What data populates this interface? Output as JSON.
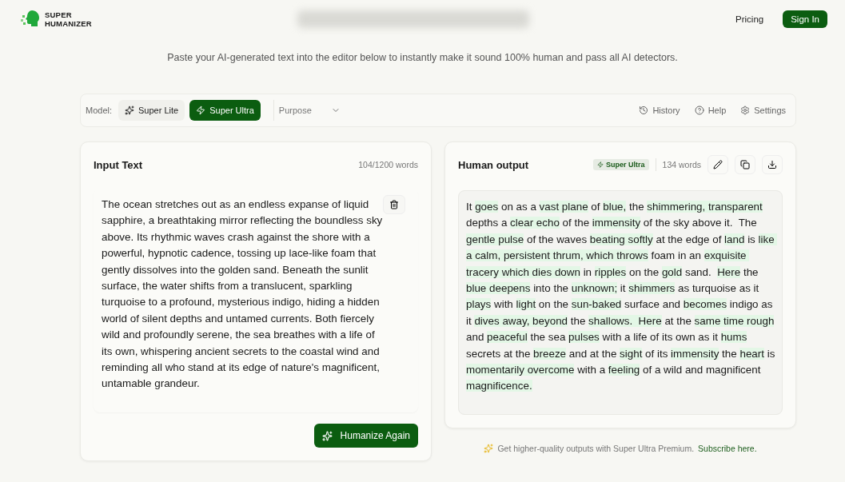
{
  "header": {
    "logo": [
      "SUPER",
      "HUMANIZER"
    ],
    "nav": [
      {
        "label": "Pricing",
        "kind": "link"
      },
      {
        "label": "Sign In",
        "kind": "button"
      }
    ]
  },
  "subtitle": "Paste your AI-generated text into the editor below to instantly make it sound 100% human and pass all AI detectors.",
  "toolbar": {
    "model_label": "Model:",
    "models": [
      {
        "label": "Super Lite",
        "selected": false
      },
      {
        "label": "Super Ultra",
        "selected": true
      }
    ],
    "purpose": {
      "placeholder": "Purpose"
    },
    "actions": [
      {
        "label": "History",
        "kind": "history"
      },
      {
        "label": "Help",
        "kind": "help"
      },
      {
        "label": "Settings",
        "kind": "settings"
      }
    ]
  },
  "input": {
    "title": "Input Text",
    "count": "104/1200 words",
    "text": "The ocean stretches out as an endless expanse of liquid sapphire, a breathtaking mirror reflecting the boundless sky above. Its rhythmic waves crash against the shore with a powerful, hypnotic cadence, tossing up lace-like foam that gently dissolves into the golden sand. Beneath the sunlit surface, the water shifts from a translucent, sparkling turquoise to a profound, mysterious indigo, hiding a hidden world of silent depths and untamed currents. Both fiercely wild and profoundly serene, the sea breathes with a life of its own, whispering ancient secrets to the coastal wind and reminding all who stand at its edge of nature's magnificent, untamable grandeur.",
    "button": "Humanize Again"
  },
  "output": {
    "title": "Human output",
    "badge": "Super Ultra",
    "count": "134 words",
    "segments": [
      {
        "text": "It ",
        "highlighted": false
      },
      {
        "text": "goes",
        "highlighted": true
      },
      {
        "text": " on as a ",
        "highlighted": false
      },
      {
        "text": "vast plane",
        "highlighted": true
      },
      {
        "text": " of ",
        "highlighted": false
      },
      {
        "text": "blue,",
        "highlighted": true
      },
      {
        "text": " the ",
        "highlighted": false
      },
      {
        "text": "shimmering, transparent",
        "highlighted": true
      },
      {
        "text": " depths a ",
        "highlighted": false
      },
      {
        "text": "clear echo",
        "highlighted": true
      },
      {
        "text": " of the ",
        "highlighted": false
      },
      {
        "text": "immensity",
        "highlighted": true
      },
      {
        "text": " of the sky above it.  The ",
        "highlighted": false
      },
      {
        "text": "gentle pulse",
        "highlighted": true
      },
      {
        "text": " of the waves ",
        "highlighted": false
      },
      {
        "text": "beating softly",
        "highlighted": true
      },
      {
        "text": " at the edge of ",
        "highlighted": false
      },
      {
        "text": "land",
        "highlighted": true
      },
      {
        "text": " is ",
        "highlighted": false
      },
      {
        "text": "like a calm, persistent thrum, which throws",
        "highlighted": true
      },
      {
        "text": " foam in an ",
        "highlighted": false
      },
      {
        "text": "exquisite tracery which dies down",
        "highlighted": true
      },
      {
        "text": " in ",
        "highlighted": false
      },
      {
        "text": "ripples",
        "highlighted": true
      },
      {
        "text": " on the ",
        "highlighted": false
      },
      {
        "text": "gold",
        "highlighted": true
      },
      {
        "text": " sand.  ",
        "highlighted": false
      },
      {
        "text": "Here",
        "highlighted": true
      },
      {
        "text": " the ",
        "highlighted": false
      },
      {
        "text": "blue deepens",
        "highlighted": true
      },
      {
        "text": " into the ",
        "highlighted": false
      },
      {
        "text": "unknown;",
        "highlighted": true
      },
      {
        "text": " it ",
        "highlighted": false
      },
      {
        "text": "shimmers",
        "highlighted": true
      },
      {
        "text": " as turquoise as it ",
        "highlighted": false
      },
      {
        "text": "plays",
        "highlighted": true
      },
      {
        "text": " with ",
        "highlighted": false
      },
      {
        "text": "light",
        "highlighted": true
      },
      {
        "text": " on the ",
        "highlighted": false
      },
      {
        "text": "sun-baked",
        "highlighted": true
      },
      {
        "text": " surface and ",
        "highlighted": false
      },
      {
        "text": "becomes",
        "highlighted": true
      },
      {
        "text": " indigo as it ",
        "highlighted": false
      },
      {
        "text": "dives away, beyond",
        "highlighted": true
      },
      {
        "text": " the ",
        "highlighted": false
      },
      {
        "text": "shallows.  Here",
        "highlighted": true
      },
      {
        "text": " at the ",
        "highlighted": false
      },
      {
        "text": "same time rough",
        "highlighted": true
      },
      {
        "text": " and ",
        "highlighted": false
      },
      {
        "text": "peaceful",
        "highlighted": true
      },
      {
        "text": " the sea ",
        "highlighted": false
      },
      {
        "text": "pulses",
        "highlighted": true
      },
      {
        "text": " with a life of its own as it ",
        "highlighted": false
      },
      {
        "text": "hums",
        "highlighted": true
      },
      {
        "text": " secrets at the ",
        "highlighted": false
      },
      {
        "text": "breeze",
        "highlighted": true
      },
      {
        "text": " and at the ",
        "highlighted": false
      },
      {
        "text": "sight",
        "highlighted": true
      },
      {
        "text": " of its ",
        "highlighted": false
      },
      {
        "text": "immensity",
        "highlighted": true
      },
      {
        "text": " the ",
        "highlighted": false
      },
      {
        "text": "heart",
        "highlighted": true
      },
      {
        "text": " is ",
        "highlighted": false
      },
      {
        "text": "momentarily overcome",
        "highlighted": true
      },
      {
        "text": " with a ",
        "highlighted": false
      },
      {
        "text": "feeling",
        "highlighted": true
      },
      {
        "text": " of a wild and magnificent ",
        "highlighted": false
      },
      {
        "text": "magnificence.",
        "highlighted": true
      }
    ]
  },
  "promo": {
    "text": "Get higher-quality outputs with Super Ultra Premium.",
    "link": "Subscribe here."
  }
}
